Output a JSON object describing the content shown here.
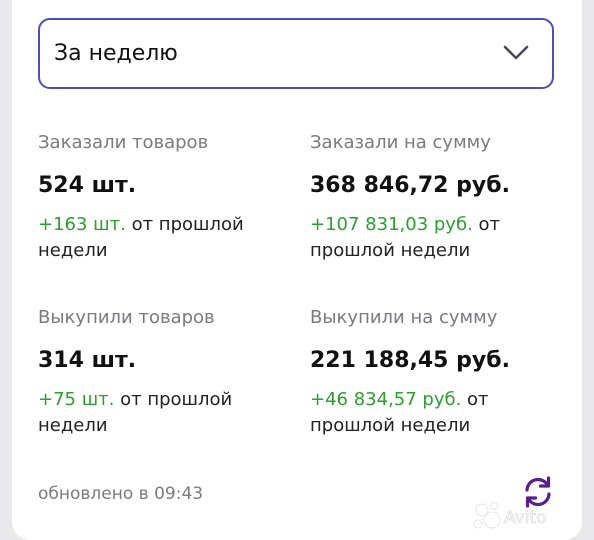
{
  "period_select": {
    "value": "За неделю",
    "icon": "chevron-down-icon"
  },
  "stats": {
    "ordered_items": {
      "label": "Заказали товаров",
      "value": "524 шт.",
      "delta": "+163 шт.",
      "delta_suffix": "от прошлой недели"
    },
    "ordered_sum": {
      "label": "Заказали на сумму",
      "value": "368 846,72 руб.",
      "delta": "+107 831,03 руб.",
      "delta_suffix": "от прошлой недели"
    },
    "bought_items": {
      "label": "Выкупили товаров",
      "value": "314 шт.",
      "delta": "+75 шт.",
      "delta_suffix": "от прошлой недели"
    },
    "bought_sum": {
      "label": "Выкупили на сумму",
      "value": "221 188,45 руб.",
      "delta": "+46 834,57 руб.",
      "delta_suffix": "от прошлой недели"
    }
  },
  "footer": {
    "updated": "обновлено в 09:43",
    "refresh_icon": "refresh-icon"
  },
  "colors": {
    "accent": "#4b4fbd",
    "positive": "#2e9e2e",
    "muted": "#7a7a80",
    "refresh": "#5b1f8c"
  },
  "watermark": {
    "text": "Avito"
  }
}
